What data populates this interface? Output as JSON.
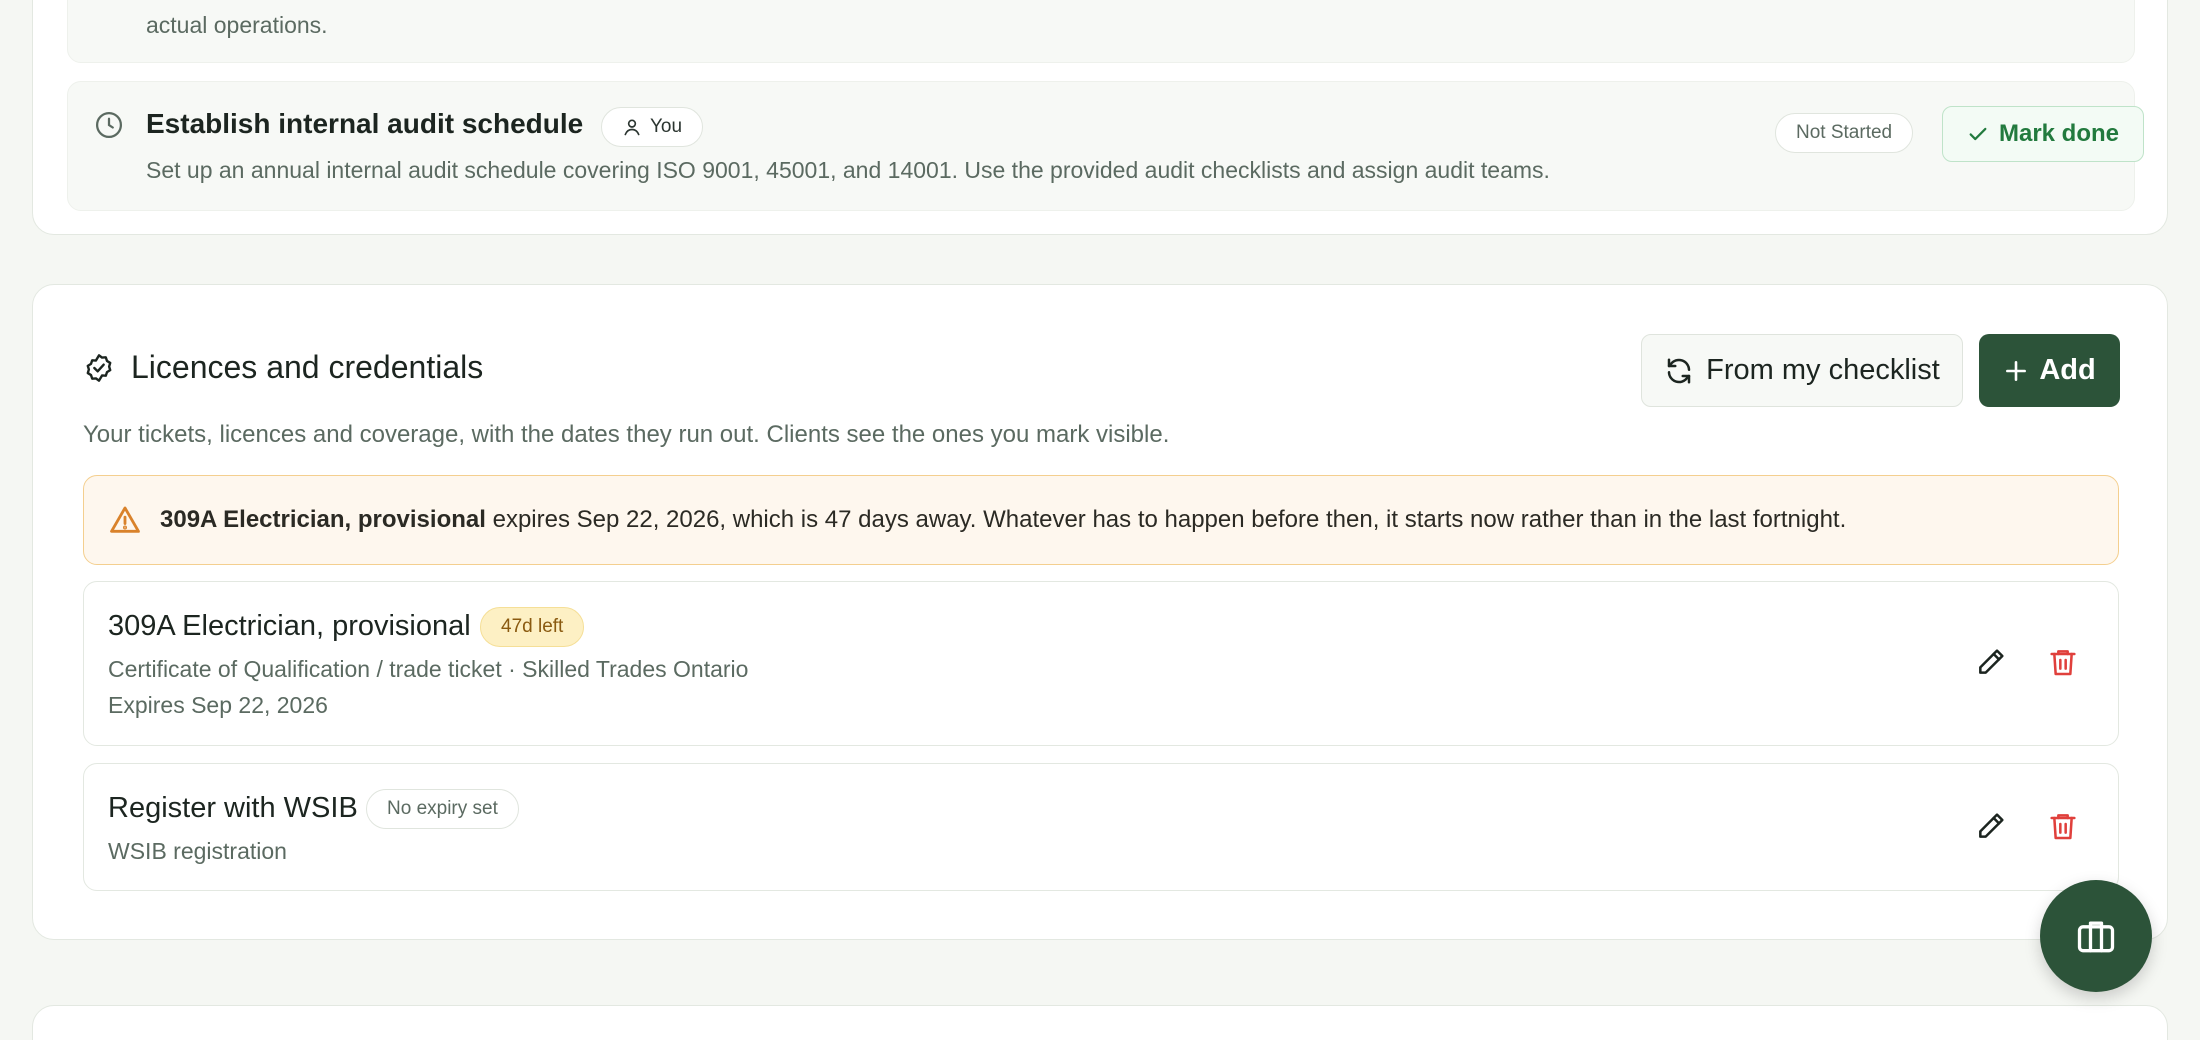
{
  "tasks": {
    "previous": {
      "description_tail": "actual operations."
    },
    "audit": {
      "title": "Establish internal audit schedule",
      "assignee": "You",
      "description": "Set up an annual internal audit schedule covering ISO 9001, 45001, and 14001. Use the provided audit checklists and assign audit teams.",
      "status": "Not Started",
      "action_label": "Mark done"
    }
  },
  "licences": {
    "title": "Licences and credentials",
    "subtitle": "Your tickets, licences and coverage, with the dates they run out. Clients see the ones you mark visible.",
    "checklist_button": "From my checklist",
    "add_button": "Add",
    "alert": {
      "name": "309A Electrician, provisional",
      "message": " expires Sep 22, 2026, which is 47 days away. Whatever has to happen before then, it starts now rather than in the last fortnight."
    },
    "items": [
      {
        "name": "309A Electrician, provisional",
        "badge": "47d left",
        "detail": "Certificate of Qualification / trade ticket · Skilled Trades Ontario",
        "expiry": "Expires Sep 22, 2026"
      },
      {
        "name": "Register with WSIB",
        "badge": "No expiry set",
        "detail": "WSIB registration"
      }
    ]
  },
  "colors": {
    "primary": "#2c5339",
    "success": "#227a3e",
    "warning_bg": "#fef7ee",
    "danger": "#e0403c"
  },
  "icons": {
    "clock": "clock-icon",
    "user": "user-icon",
    "check": "check-icon",
    "badge_check": "badge-check-icon",
    "refresh": "refresh-icon",
    "plus": "plus-icon",
    "warning": "warning-icon",
    "edit": "pencil-icon",
    "delete": "trash-icon",
    "briefcase": "briefcase-icon"
  }
}
